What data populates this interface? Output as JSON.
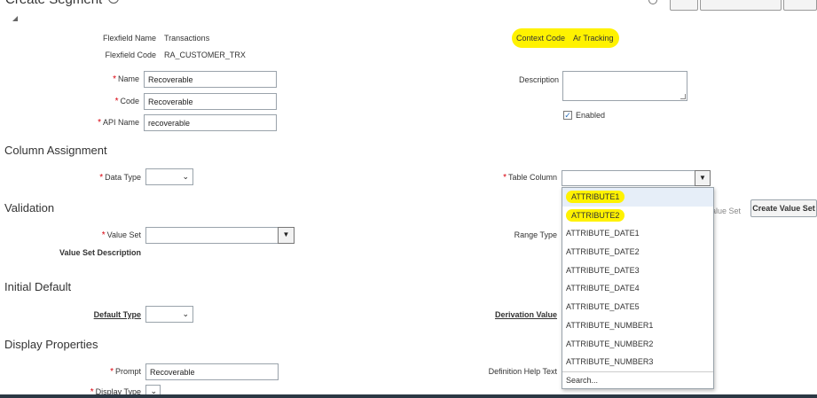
{
  "page_title": "Create Segment",
  "fields": {
    "flexfield_name_label": "Flexfield Name",
    "flexfield_name_value": "Transactions",
    "flexfield_code_label": "Flexfield Code",
    "flexfield_code_value": "RA_CUSTOMER_TRX",
    "context_code_label": "Context Code",
    "context_code_value": "Ar Tracking",
    "name_label": "Name",
    "name_value": "Recoverable",
    "code_label": "Code",
    "code_value": "Recoverable",
    "api_name_label": "API Name",
    "api_name_value": "recoverable",
    "description_label": "Description",
    "enabled_label": "Enabled",
    "enabled_checked": true
  },
  "column_assignment": {
    "heading": "Column Assignment",
    "data_type_label": "Data Type",
    "table_column_label": "Table Column",
    "table_column_value": ""
  },
  "validation": {
    "heading": "Validation",
    "value_set_label": "Value Set",
    "value_set_description_label": "Value Set Description",
    "range_type_label": "Range Type",
    "partial_button_label": "alue Set",
    "create_value_set_label": "Create Value Set"
  },
  "initial_default": {
    "heading": "Initial Default",
    "default_type_label": "Default Type",
    "derivation_value_label": "Derivation Value"
  },
  "display_properties": {
    "heading": "Display Properties",
    "prompt_label": "Prompt",
    "prompt_value": "Recoverable",
    "display_type_label": "Display Type",
    "definition_help_text_label": "Definition Help Text"
  },
  "dropdown": {
    "items": [
      "ATTRIBUTE1",
      "ATTRIBUTE2",
      "ATTRIBUTE_DATE1",
      "ATTRIBUTE_DATE2",
      "ATTRIBUTE_DATE3",
      "ATTRIBUTE_DATE4",
      "ATTRIBUTE_DATE5",
      "ATTRIBUTE_NUMBER1",
      "ATTRIBUTE_NUMBER2",
      "ATTRIBUTE_NUMBER3"
    ],
    "search_label": "Search...",
    "highlight_color": "#fff200"
  }
}
